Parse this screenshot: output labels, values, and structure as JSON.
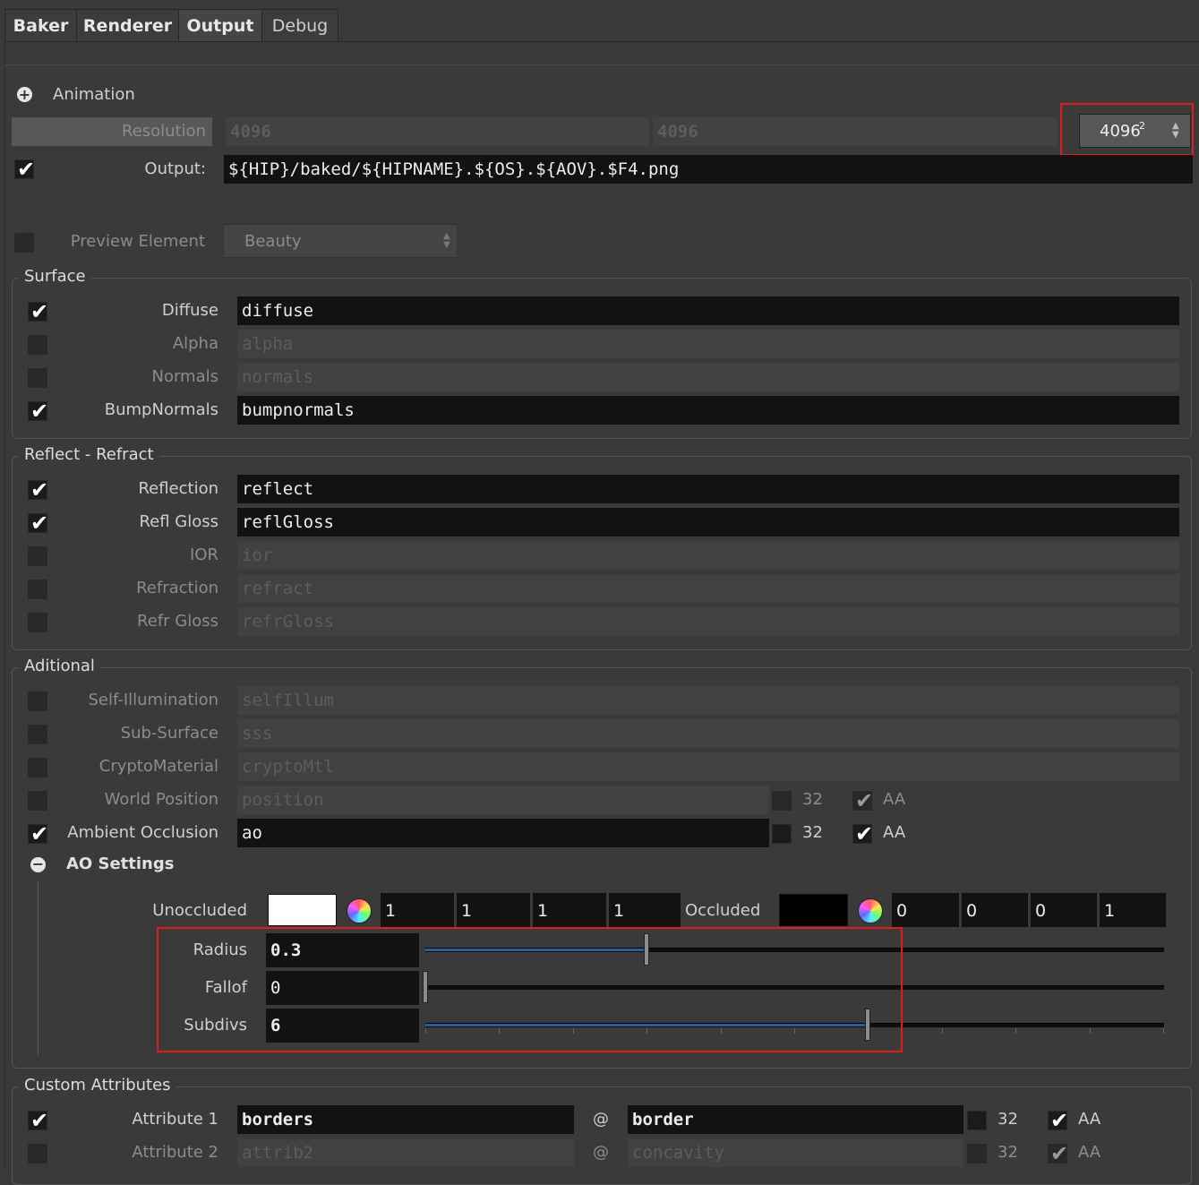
{
  "tabs": [
    "Baker",
    "Renderer",
    "Output",
    "Debug"
  ],
  "animation_label": "Animation",
  "resolution": {
    "label": "Resolution",
    "width": "4096",
    "height": "4096",
    "preset": "4096",
    "preset_sup": "2"
  },
  "output": {
    "label": "Output:",
    "path": "${HIP}/baked/${HIPNAME}.${OS}.${AOV}.$F4.png"
  },
  "preview": {
    "label": "Preview Element",
    "value": "Beauty"
  },
  "surface": {
    "title": "Surface",
    "rows": [
      {
        "label": "Diffuse",
        "value": "diffuse",
        "checked": true
      },
      {
        "label": "Alpha",
        "value": "alpha",
        "checked": false
      },
      {
        "label": "Normals",
        "value": "normals",
        "checked": false
      },
      {
        "label": "BumpNormals",
        "value": "bumpnormals",
        "checked": true
      }
    ]
  },
  "reflect": {
    "title": "Reflect - Refract",
    "rows": [
      {
        "label": "Reflection",
        "value": "reflect",
        "checked": true
      },
      {
        "label": "Refl Gloss",
        "value": "reflGloss",
        "checked": true
      },
      {
        "label": "IOR",
        "value": "ior",
        "checked": false
      },
      {
        "label": "Refraction",
        "value": "refract",
        "checked": false
      },
      {
        "label": "Refr Gloss",
        "value": "refrGloss",
        "checked": false
      }
    ]
  },
  "additional": {
    "title": "Aditional",
    "rows": [
      {
        "label": "Self-Illumination",
        "value": "selfIllum",
        "checked": false
      },
      {
        "label": "Sub-Surface",
        "value": "sss",
        "checked": false
      },
      {
        "label": "CryptoMaterial",
        "value": "cryptoMtl",
        "checked": false
      },
      {
        "label": "World Position",
        "value": "position",
        "checked": false,
        "bits": "32",
        "aa": "AA"
      },
      {
        "label": "Ambient Occlusion",
        "value": "ao",
        "checked": true,
        "bits": "32",
        "aa": "AA"
      }
    ]
  },
  "ao_settings": {
    "title": "AO Settings",
    "unoccluded_label": "Unoccluded",
    "unoccluded_color": "#ffffff",
    "unoccluded_values": [
      "1",
      "1",
      "1",
      "1"
    ],
    "occluded_label": "Occluded",
    "occluded_color": "#000000",
    "occluded_values": [
      "0",
      "0",
      "0",
      "1"
    ],
    "radius": {
      "label": "Radius",
      "value": "0.3"
    },
    "falloff": {
      "label": "Fallof",
      "value": "0"
    },
    "subdivs": {
      "label": "Subdivs",
      "value": "6"
    }
  },
  "custom": {
    "title": "Custom Attributes",
    "at": "@",
    "rows": [
      {
        "label": "Attribute 1",
        "name": "borders",
        "attr": "border",
        "checked": true,
        "bits": "32",
        "aa": "AA"
      },
      {
        "label": "Attribute 2",
        "name": "attrib2",
        "attr": "concavity",
        "checked": false,
        "bits": "32",
        "aa": "AA"
      }
    ]
  },
  "colors": {
    "highlight": "#e01b1b",
    "slider_fill": "#2e5c9c"
  }
}
